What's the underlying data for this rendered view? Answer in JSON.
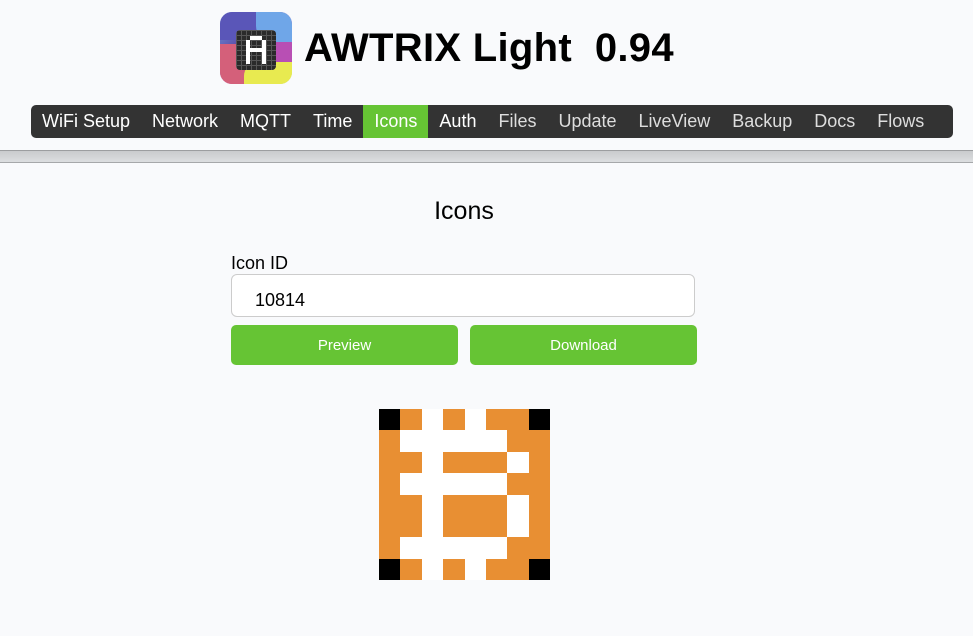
{
  "header": {
    "app_name": "AWTRIX Light",
    "version": "0.94",
    "logo_icon": "awtrix-logo-icon"
  },
  "nav": {
    "items": [
      {
        "label": "WiFi Setup",
        "active": false
      },
      {
        "label": "Network",
        "active": false
      },
      {
        "label": "MQTT",
        "active": false
      },
      {
        "label": "Time",
        "active": false
      },
      {
        "label": "Icons",
        "active": true
      },
      {
        "label": "Auth",
        "active": false
      },
      {
        "label": "Files",
        "active": false
      },
      {
        "label": "Update",
        "active": false
      },
      {
        "label": "LiveView",
        "active": false
      },
      {
        "label": "Backup",
        "active": false
      },
      {
        "label": "Docs",
        "active": false
      },
      {
        "label": "Flows",
        "active": false
      }
    ],
    "active_color": "#66c434"
  },
  "main": {
    "title": "Icons",
    "icon_id_label": "Icon ID",
    "icon_id_value": "10814",
    "preview_label": "Preview",
    "download_label": "Download",
    "button_color": "#66c434"
  },
  "icon_preview": {
    "palette": {
      "K": "#000000",
      "O": "#e88f33",
      "W": "#ffffff"
    },
    "rows": [
      "KOWOWOOK",
      "OWWWWWOO",
      "OOWOOOWO",
      "OWWWWWOO",
      "OOWOOOWO",
      "OOWOOOWO",
      "OWWWWWOO",
      "KOWOWOOK"
    ]
  }
}
